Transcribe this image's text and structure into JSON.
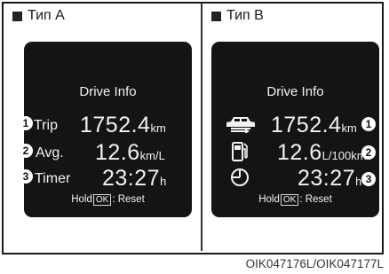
{
  "panel_a": {
    "header": "Тип A",
    "screen": {
      "title": "Drive Info",
      "rows": [
        {
          "badge": "1",
          "label": "Trip",
          "value": "1752.4",
          "unit": "km"
        },
        {
          "badge": "2",
          "label": "Avg.",
          "value": "12.6",
          "unit": "km/L"
        },
        {
          "badge": "3",
          "label": "Timer",
          "value": "23:27",
          "unit": "h"
        }
      ],
      "hold_text": "Hold",
      "ok_label": "OK",
      "reset_text": ": Reset"
    }
  },
  "panel_b": {
    "header": "Тип B",
    "screen": {
      "title": "Drive Info",
      "rows": [
        {
          "badge": "1",
          "icon": "car-icon",
          "value": "1752.4",
          "unit": "km"
        },
        {
          "badge": "2",
          "icon": "fuel-pump-icon",
          "value": "12.6",
          "unit": "L/100km"
        },
        {
          "badge": "3",
          "icon": "clock-icon",
          "value": "23:27",
          "unit": "h"
        }
      ],
      "hold_text": "Hold",
      "ok_label": "OK",
      "reset_text": ": Reset"
    }
  },
  "caption": "OIK047176L/OIK047177L"
}
